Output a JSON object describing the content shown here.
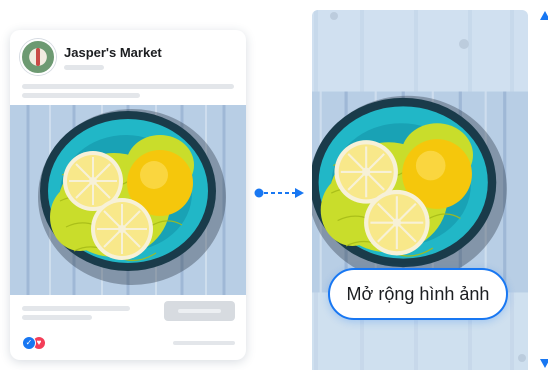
{
  "post": {
    "page_name": "Jasper's Market",
    "reactions": [
      "like-icon",
      "love-icon"
    ]
  },
  "expanded": {
    "button_label": "Mở rộng hình ảnh"
  },
  "colors": {
    "accent": "#1877f2",
    "wood": "#b9cfe6",
    "bowl": "#1fb4c4",
    "lemon": "#f7d21e",
    "net": "#c5d82c"
  },
  "icons": {
    "connector": "dashed-arrow-icon",
    "edges": [
      "chevron-up-icon",
      "chevron-down-icon"
    ]
  }
}
